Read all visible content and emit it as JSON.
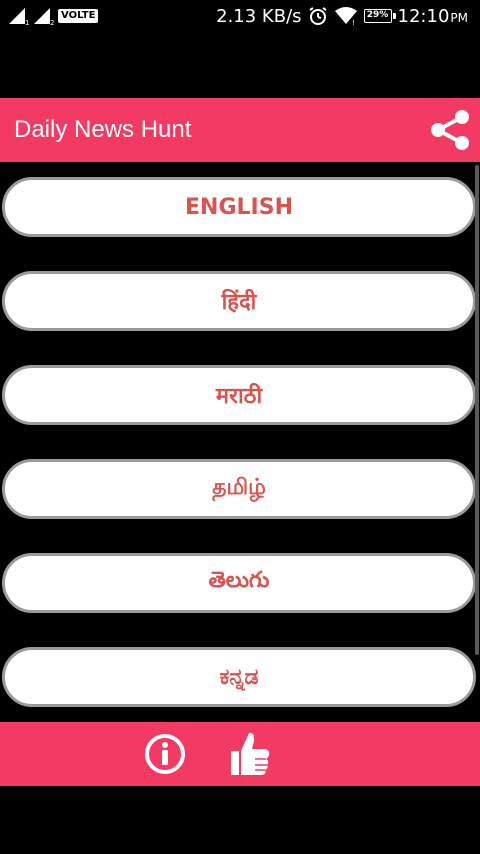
{
  "status_bar": {
    "network_badge": "VOLTE",
    "speed": "2.13 KB/s",
    "battery": "29%",
    "time": "12:10",
    "time_suffix": "PM",
    "icons": [
      "signal-icon",
      "signal-icon",
      "alarm-icon",
      "wifi-icon",
      "battery-icon"
    ]
  },
  "app_bar": {
    "title": "Daily News Hunt",
    "share_icon": "share-icon"
  },
  "languages": [
    {
      "label": "ENGLISH"
    },
    {
      "label": "हिंदी"
    },
    {
      "label": "मराठी"
    },
    {
      "label": "தமிழ்"
    },
    {
      "label": "తెలుగు"
    },
    {
      "label": "ಕನ್ನಡ"
    }
  ],
  "bottom_bar": {
    "info_icon": "info-icon",
    "like_icon": "thumbs-up-icon"
  },
  "colors": {
    "accent": "#f23a62",
    "button_text": "#d9534f",
    "background": "#000000"
  }
}
